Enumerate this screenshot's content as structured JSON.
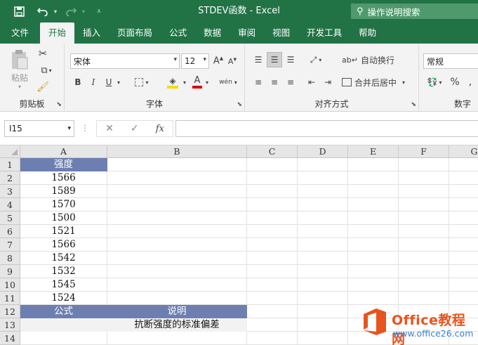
{
  "titlebar": {
    "title": "STDEV函数 - Excel",
    "tell_me": "操作说明搜索"
  },
  "tabs": [
    "文件",
    "开始",
    "插入",
    "页面布局",
    "公式",
    "数据",
    "审阅",
    "视图",
    "开发工具",
    "帮助"
  ],
  "active_tab": "开始",
  "ribbon": {
    "clipboard": {
      "label": "剪贴板",
      "paste_label": "粘贴"
    },
    "font": {
      "label": "字体",
      "font_name": "宋体",
      "font_size": "12",
      "bold": "B",
      "italic": "I",
      "underline": "U",
      "font_color_glyph": "A",
      "phonetic_glyph": "wén"
    },
    "alignment": {
      "label": "对齐方式",
      "wrap_text": "自动换行",
      "merge_center": "合并后居中"
    },
    "number": {
      "label": "数字",
      "format": "常规",
      "percent": "%"
    }
  },
  "formula_bar": {
    "name_box": "I15",
    "fx": "fx",
    "content": ""
  },
  "sheet": {
    "columns": [
      "A",
      "B",
      "C",
      "D",
      "E",
      "F",
      "G"
    ],
    "rows": [
      "1",
      "2",
      "3",
      "4",
      "5",
      "6",
      "7",
      "8",
      "9",
      "10",
      "11",
      "12",
      "13",
      "14"
    ],
    "a_header": "强度",
    "values": [
      "1566",
      "1589",
      "1570",
      "1500",
      "1521",
      "1566",
      "1542",
      "1532",
      "1545",
      "1524"
    ],
    "formula_header": "公式",
    "desc_header": "说明",
    "desc": "抗断强度的标准偏差"
  },
  "watermark": {
    "title": "Office教程网",
    "url": "www.office26.com"
  },
  "colors": {
    "excel_green": "#217346",
    "header_fill": "#6d7fb1",
    "grey_fill": "#f2f2f2",
    "watermark_orange": "#e8541e",
    "watermark_blue": "#3b7fd1"
  }
}
